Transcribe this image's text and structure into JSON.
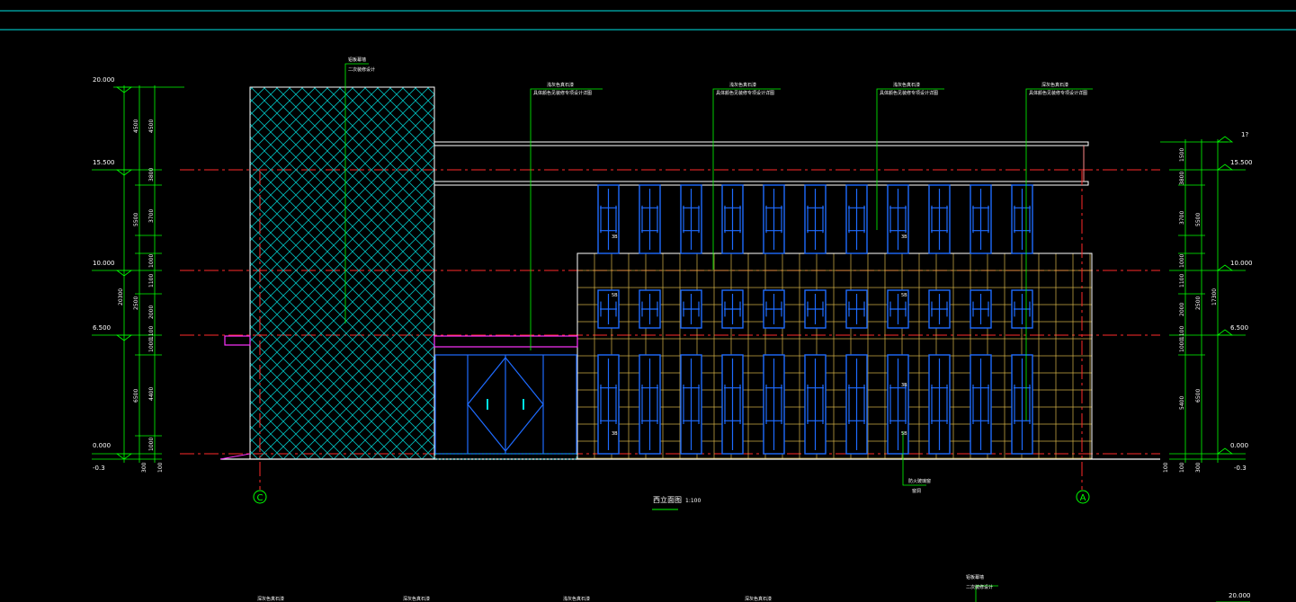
{
  "colors": {
    "background": "#000000",
    "dimension": "#00ff00",
    "axis": "#ff2a2a",
    "outline": "#ffffff",
    "hatch": "#00cccc",
    "window": "#1e6bff",
    "grid": "#ffd34d",
    "magenta": "#ff33ff",
    "cyan_line": "#00e5e5"
  },
  "drawing": {
    "title": "西立面图",
    "scale": "1:100",
    "axis_left": "C",
    "axis_right": "A"
  },
  "elevations_left": [
    "20.000",
    "15.500",
    "10.000",
    "6.500",
    "0.000",
    "-0.3"
  ],
  "elevations_right": [
    "15.500",
    "10.000",
    "6.500",
    "0.000",
    "-0.3",
    "20.000"
  ],
  "dims_left_outer": [
    "4500",
    "5500",
    "2500",
    "6500"
  ],
  "dims_left_inner": [
    "4500",
    "3800",
    "3700",
    "1000",
    "1100",
    "2000",
    "1000",
    "1100",
    "4400",
    "1000"
  ],
  "dims_left_total": "20300",
  "dims_left_bottom": [
    "300",
    "100"
  ],
  "dims_right_outer": [
    "1500",
    "3800",
    "3700",
    "1000",
    "1100",
    "2000",
    "1000",
    "1100",
    "5400",
    "100"
  ],
  "dims_right_mid": [
    "5500",
    "2500",
    "6500",
    "300"
  ],
  "dims_right_total": "17300",
  "dims_right_bottom": [
    "100"
  ],
  "dims_right_top": "1?",
  "window_tags": [
    "3B",
    "3B",
    "5B",
    "5B",
    "3B",
    "5B",
    "3B"
  ],
  "callouts": [
    "铝板幕墙",
    "二次装修设计",
    "浅灰色真石漆",
    "具体颜色见装修专项设计详图",
    "浅灰色真石漆",
    "具体颜色见装修专项设计详图",
    "浅灰色真石漆",
    "具体颜色见装修专项设计详图",
    "深灰色真石漆",
    "具体颜色见装修专项设计详图",
    "防火玻璃窗",
    "窗洞"
  ],
  "bottom_callouts": [
    "深灰色真石漆",
    "深灰色真石漆",
    "浅灰色真石漆",
    "深灰色真石漆",
    "铝板幕墙",
    "二次装修设计"
  ]
}
